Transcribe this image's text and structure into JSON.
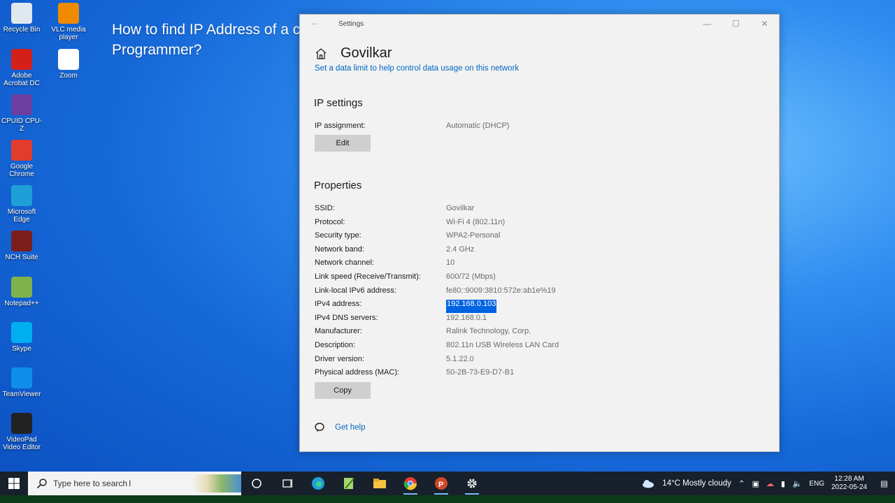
{
  "desktop": {
    "icons": [
      {
        "label": "Recycle Bin",
        "icon": "recycle-bin-icon",
        "color": "#dfe7ef"
      },
      {
        "label": "VLC media player",
        "icon": "vlc-icon",
        "color": "#f08a00"
      },
      {
        "label": "Adobe Acrobat DC",
        "icon": "acrobat-icon",
        "color": "#d3201b"
      },
      {
        "label": "Zoom",
        "icon": "zoom-file-icon",
        "color": "#ffffff"
      },
      {
        "label": "CPUID CPU-Z",
        "icon": "cpuz-icon",
        "color": "#6a3fa0"
      },
      {
        "label": "Google Chrome",
        "icon": "chrome-icon",
        "color": "#e33b2e"
      },
      {
        "label": "Microsoft Edge",
        "icon": "edge-icon",
        "color": "#1f9fd8"
      },
      {
        "label": "NCH Suite",
        "icon": "nch-suite-icon",
        "color": "#7a1e1e"
      },
      {
        "label": "Notepad++",
        "icon": "notepadpp-icon",
        "color": "#7fb24a"
      },
      {
        "label": "Skype",
        "icon": "skype-icon",
        "color": "#00aff0"
      },
      {
        "label": "TeamViewer",
        "icon": "teamviewer-icon",
        "color": "#0e8ee9"
      },
      {
        "label": "VideoPad Video Editor",
        "icon": "videopad-icon",
        "color": "#222222"
      }
    ]
  },
  "overlay_title": "How to find IP Address of a computer as Programmer?",
  "window": {
    "title": "Settings",
    "page_title": "Govilkar",
    "data_limit_link": "Set a data limit to help control data usage on this network",
    "ip_settings": {
      "heading": "IP settings",
      "assignment_label": "IP assignment:",
      "assignment_value": "Automatic (DHCP)",
      "edit_button": "Edit"
    },
    "properties": {
      "heading": "Properties",
      "rows": [
        {
          "label": "SSID:",
          "value": "Govilkar"
        },
        {
          "label": "Protocol:",
          "value": "Wi-Fi 4 (802.11n)"
        },
        {
          "label": "Security type:",
          "value": "WPA2-Personal"
        },
        {
          "label": "Network band:",
          "value": "2.4 GHz"
        },
        {
          "label": "Network channel:",
          "value": "10"
        },
        {
          "label": "Link speed (Receive/Transmit):",
          "value": "600/72 (Mbps)"
        },
        {
          "label": "Link-local IPv6 address:",
          "value": "fe80::9009:3810:572e:ab1e%19"
        },
        {
          "label": "IPv4 address:",
          "value": "192.168.0.103"
        },
        {
          "label": "IPv4 DNS servers:",
          "value": "192.168.0.1"
        },
        {
          "label": "Manufacturer:",
          "value": "Ralink Technology, Corp."
        },
        {
          "label": "Description:",
          "value": "802.11n USB Wireless LAN Card"
        },
        {
          "label": "Driver version:",
          "value": "5.1.22.0"
        },
        {
          "label": "Physical address (MAC):",
          "value": "50-2B-73-E9-D7-B1"
        }
      ],
      "copy_button": "Copy"
    },
    "help_link": "Get help"
  },
  "taskbar": {
    "search_placeholder": "Type here to search",
    "weather": "14°C  Mostly cloudy",
    "language": "ENG",
    "time": "12:28 AM",
    "date": "2022-05-24"
  },
  "colors": {
    "accent": "#0067c0",
    "selection": "#0063e1",
    "taskbar": "#17202b"
  }
}
